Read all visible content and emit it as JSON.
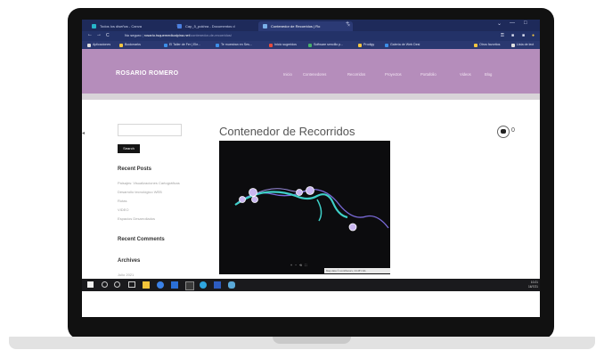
{
  "browser": {
    "tabs": [
      {
        "label": "Todos los diseños - Canva",
        "favicon": "canva-icon",
        "color": "#27b5c9"
      },
      {
        "label": "Cap_5_pokhra - Documentos d",
        "favicon": "docs-icon",
        "color": "#4a7fe0"
      },
      {
        "label": "Contenedor de Recorridos | Ro",
        "favicon": "site-icon",
        "color": "#7ab0e8"
      }
    ],
    "new_tab": "+",
    "window_controls": [
      "⌄",
      "—",
      "□"
    ],
    "nav": {
      "back": "←",
      "forward": "→",
      "reload": "C"
    },
    "address": {
      "prefix": "No seguro",
      "host": "rosario.tsquemedicalpina.net",
      "path": "/contenedor-de-recorridos/"
    },
    "bookmarks": [
      {
        "label": "Aplicaciones",
        "color": "#e0e0e0"
      },
      {
        "label": "Bookmarks",
        "color": "#f3c640"
      },
      {
        "label": "El Taller de Fer | Ele...",
        "color": "#3c8ee8"
      },
      {
        "label": "Te muestran en Ses...",
        "color": "#3c8ee8"
      },
      {
        "label": "Inicio sugeridos",
        "color": "#e84c3c"
      },
      {
        "label": "Software sencillo p...",
        "color": "#46b06a"
      },
      {
        "label": "Prodigy",
        "color": "#f3c640"
      },
      {
        "label": "Galería de Web Desi",
        "color": "#3c8ee8"
      },
      {
        "label": "Otros favoritos",
        "color": "#f3c640"
      },
      {
        "label": "Lista de lect",
        "color": "#e0e0e0"
      }
    ]
  },
  "site": {
    "title": "ROSARIO ROMERO",
    "nav_items": [
      "Inicio",
      "Contenedores",
      "Recorridos",
      "Proyectos",
      "Portafolio",
      "Videos",
      "Blog"
    ],
    "header_color": "#b58dbb"
  },
  "sidebar": {
    "search_button": "Search",
    "recent_posts_title": "Recent Posts",
    "recent_posts": [
      "Paisajes: Visualizaciones Cartográficas",
      "Desarrollo tecnológico WEB",
      "Rutas",
      "VIDEO",
      "Espacios Desarrollados"
    ],
    "recent_comments_title": "Recent Comments",
    "archives_title": "Archives",
    "archive_items": [
      "Julio 2021"
    ]
  },
  "main": {
    "page_title": "Contenedor de Recorridos",
    "comment_count": "0",
    "map": {
      "controls": "+ − ⟲ ⛶",
      "attribution": "Map data © contributors, CC-BY-SA"
    }
  },
  "taskbar": {
    "time": "10:21",
    "date": "16/7/21",
    "icons": [
      "windows-start-icon",
      "search-icon",
      "cortana-icon",
      "task-view-icon",
      "file-explorer-icon",
      "chrome-icon",
      "mail-icon",
      "photoshop-icon",
      "edge-icon",
      "word-icon",
      "cloud-icon"
    ]
  }
}
